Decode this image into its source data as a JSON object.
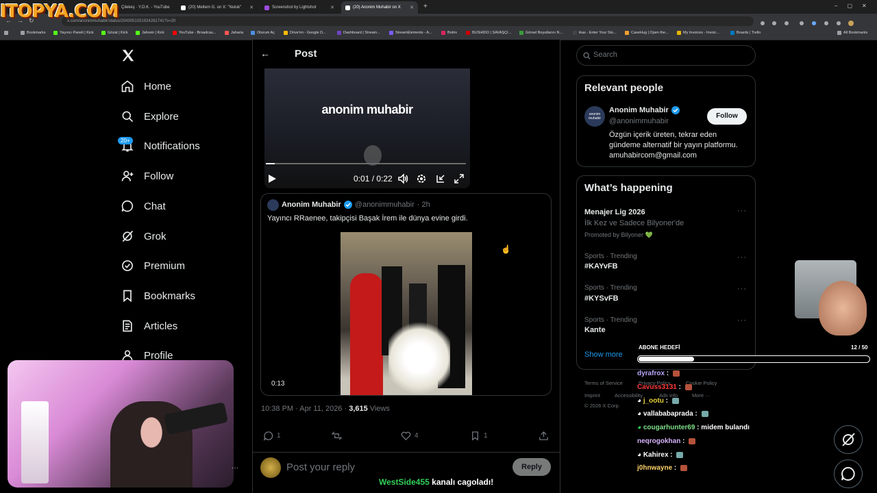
{
  "browser": {
    "tabs": [
      {
        "label": "Çilekeş · Y.O.K. - YouTube",
        "color": "#ff0000"
      },
      {
        "label": "(20) Meltem G. on X: \"Nutuk\"",
        "color": "#ffffff"
      },
      {
        "label": "Screenshot by Lightshot",
        "color": "#a04ce0"
      },
      {
        "label": "(20) Anonim Muhabir on X",
        "color": "#ffffff",
        "active": true
      }
    ],
    "url": "x.com/anonimmuhabir/status/2043051031924281741?s=20",
    "bookmarks": [
      {
        "label": "Bookmarks",
        "color": "#9aa0a6"
      },
      {
        "label": "Yayıncı Paneli | Kick",
        "color": "#53fc18"
      },
      {
        "label": "Gözat | Kick",
        "color": "#53fc18"
      },
      {
        "label": "Jahrein | Kick",
        "color": "#53fc18"
      },
      {
        "label": "YouTube - Broadcas...",
        "color": "#ff0000"
      },
      {
        "label": "Jaharia",
        "color": "#ff5555"
      },
      {
        "label": "Oturum Aç",
        "color": "#4a90e2"
      },
      {
        "label": "Drive'ım - Google D...",
        "color": "#fbbc05"
      },
      {
        "label": "Dashboard | Stream...",
        "color": "#6f42c1"
      },
      {
        "label": "StreamElements - A...",
        "color": "#7b5cff"
      },
      {
        "label": "Botrix",
        "color": "#e0245e"
      },
      {
        "label": "BUSHIDO | SAVAŞÇI...",
        "color": "#d00000"
      },
      {
        "label": "Görsel Boyutlarını N...",
        "color": "#3b9c3b"
      },
      {
        "label": "ikas - Enter Your Sto...",
        "color": "#222222"
      },
      {
        "label": "CaseHug | Open the...",
        "color": "#f0a030"
      },
      {
        "label": "My Invoices - Invoic...",
        "color": "#e8b500"
      },
      {
        "label": "Boards | Trello",
        "color": "#0079bf"
      },
      {
        "label": "All Bookmarks",
        "color": "#9aa0a6"
      }
    ]
  },
  "watermark": "ITOPYA.COM",
  "nav": {
    "items": [
      {
        "label": "Home",
        "icon": "home-icon"
      },
      {
        "label": "Explore",
        "icon": "search-icon"
      },
      {
        "label": "Notifications",
        "icon": "bell-icon",
        "badge": "20+"
      },
      {
        "label": "Follow",
        "icon": "person-add-icon"
      },
      {
        "label": "Chat",
        "icon": "chat-icon"
      },
      {
        "label": "Grok",
        "icon": "grok-icon"
      },
      {
        "label": "Premium",
        "icon": "premium-icon"
      },
      {
        "label": "Bookmarks",
        "icon": "bookmark-icon"
      },
      {
        "label": "Articles",
        "icon": "article-icon"
      },
      {
        "label": "Profile",
        "icon": "profile-icon"
      }
    ]
  },
  "post": {
    "header": "Post",
    "video": {
      "brand": "anonim muhabir",
      "time": "0:01 / 0:22",
      "progress": 0.045
    },
    "quote": {
      "name": "Anonim Muhabir",
      "handle": "@anonimmuhabir",
      "age": "· 2h",
      "text": "Yayıncı RRaenee, takipçisi Başak İrem ile dünya evine girdi.",
      "video_time": "0:13"
    },
    "meta": {
      "datetime": "10:38 PM · Apr 11, 2026 · ",
      "views_count": "3,615",
      "views_label": " Views"
    },
    "actions": {
      "replies": "1",
      "reposts": "",
      "likes": "4",
      "bookmarks": "1"
    },
    "reply": {
      "placeholder": "Post your reply",
      "button": "Reply"
    }
  },
  "right": {
    "search_placeholder": "Search",
    "relevant": {
      "title": "Relevant people",
      "name": "Anonim Muhabir",
      "handle": "@anonimmuhabir",
      "follow": "Follow",
      "bio_line1": "Özgün içerik üreten, tekrar eden",
      "bio_line2": "gündeme alternatif bir yayın platformu.",
      "bio_line3": "amuhabircom@gmail.com",
      "avatar_text": "anonim muhabir"
    },
    "happening": {
      "title": "What’s happening",
      "trends": [
        {
          "context": "",
          "name": "Menajer Lig 2026",
          "sub": "İlk Kez ve Sadece Bilyoner'de",
          "promo": "Promoted by Bilyoner 💚"
        },
        {
          "context": "Sports · Trending",
          "name": "#KAYvFB"
        },
        {
          "context": "Sports · Trending",
          "name": "#KYSvFB"
        },
        {
          "context": "Sports · Trending",
          "name": "Kante"
        }
      ],
      "show_more": "Show more"
    },
    "footer": {
      "line1a": "Terms of Service",
      "line1b": "Privacy Policy",
      "line1c": "Cookie Policy",
      "line2a": "Imprint",
      "line2b": "Accessibility",
      "line2c": "Ads info",
      "line2d": "More ···",
      "line3": "© 2026 X Corp."
    }
  },
  "overlay": {
    "goal_label": "ABONE HEDEFİ",
    "goal_count": "12 / 50",
    "goal_fraction": 0.24,
    "chat": [
      {
        "user": "dyrafrox",
        "color": "#bba8ff",
        "msg": ""
      },
      {
        "user": "Cavuss3131",
        "color": "#ff3b3b",
        "msg": ""
      },
      {
        "user": "j_ootu",
        "color": "#e8d23a",
        "msg": ""
      },
      {
        "user": "vallababaprada",
        "color": "#ffffff",
        "msg": ""
      },
      {
        "user": "cougarhunter69",
        "color": "#7fe08a",
        "msg": "midem bulandı"
      },
      {
        "user": "neqrogokhan",
        "color": "#d9b3ff",
        "msg": ""
      },
      {
        "user": "Kahirex",
        "color": "#ffffff",
        "msg": ""
      },
      {
        "user": "j0hnwayne",
        "color": "#ffd36b",
        "msg": ""
      }
    ],
    "bottom_user": "WestSide455",
    "bottom_msg": " kanalı cagoladı!"
  }
}
